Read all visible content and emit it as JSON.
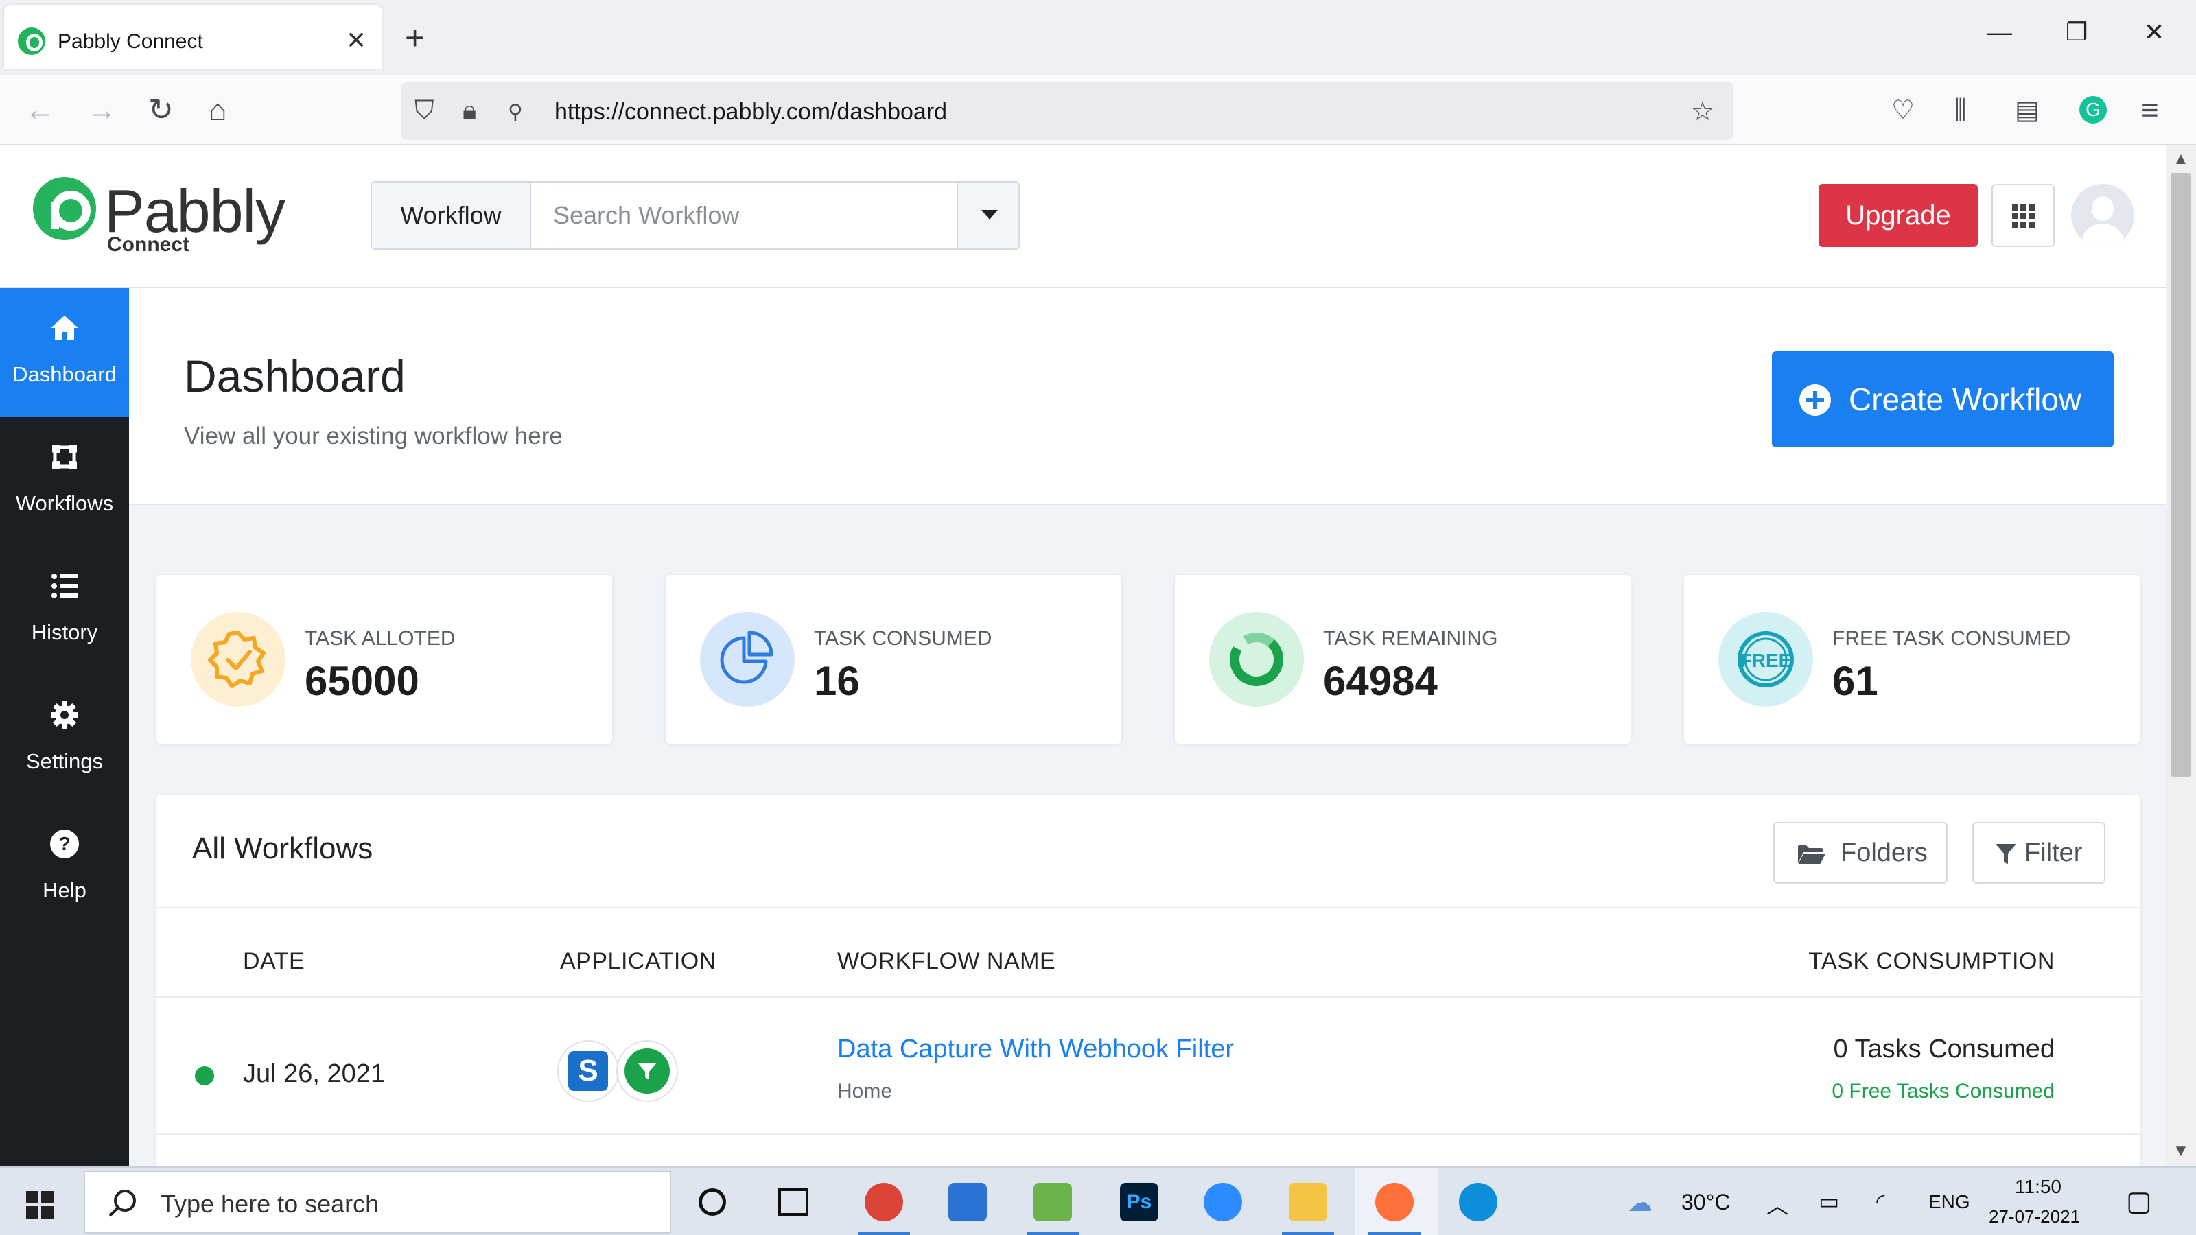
{
  "browser": {
    "tab_title": "Pabbly Connect",
    "url": "https://connect.pabbly.com/dashboard"
  },
  "header": {
    "logo_text": "Pabbly",
    "logo_subtext": "Connect",
    "search_label": "Workflow",
    "search_placeholder": "Search Workflow",
    "upgrade_label": "Upgrade"
  },
  "sidebar": {
    "items": [
      {
        "label": "Dashboard",
        "icon": "home-icon",
        "active": true
      },
      {
        "label": "Workflows",
        "icon": "workflows-icon",
        "active": false
      },
      {
        "label": "History",
        "icon": "list-icon",
        "active": false
      },
      {
        "label": "Settings",
        "icon": "gear-icon",
        "active": false
      },
      {
        "label": "Help",
        "icon": "question-icon",
        "active": false
      }
    ]
  },
  "main": {
    "title": "Dashboard",
    "subtitle": "View all your existing workflow here",
    "create_label": "Create Workflow"
  },
  "stats": [
    {
      "label": "TASK ALLOTED",
      "value": "65000",
      "icon": "badge-check-icon",
      "color": "#f5a623"
    },
    {
      "label": "TASK CONSUMED",
      "value": "16",
      "icon": "pie-chart-icon",
      "color": "#2f7be0"
    },
    {
      "label": "TASK REMAINING",
      "value": "64984",
      "icon": "ring-chart-icon",
      "color": "#1aa34a"
    },
    {
      "label": "FREE TASK CONSUMED",
      "value": "61",
      "icon": "free-badge-icon",
      "color": "#17a2b8"
    }
  ],
  "workflows": {
    "title": "All Workflows",
    "folders_label": "Folders",
    "filter_label": "Filter",
    "columns": [
      "DATE",
      "APPLICATION",
      "WORKFLOW NAME",
      "TASK CONSUMPTION"
    ],
    "rows": [
      {
        "date": "Jul 26, 2021",
        "apps": [
          "S",
          "filter-icon"
        ],
        "name": "Data Capture With Webhook Filter",
        "folder": "Home",
        "tasks": "0 Tasks Consumed",
        "free_tasks": "0 Free Tasks Consumed"
      }
    ]
  },
  "taskbar": {
    "search_placeholder": "Type here to search",
    "weather": "30°C",
    "language": "ENG",
    "time": "11:50",
    "date": "27-07-2021"
  },
  "colors": {
    "primary": "#1a7ff0",
    "danger": "#dc3545",
    "success": "#1aa34a",
    "sidebar_bg": "#1b1f24"
  }
}
